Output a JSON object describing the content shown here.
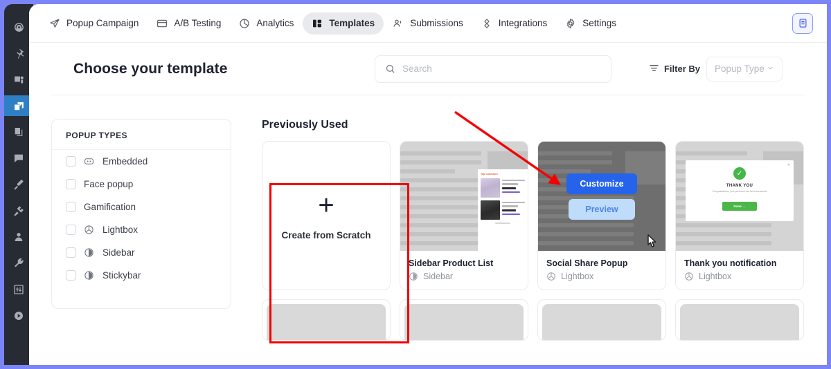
{
  "rail": {
    "items": [
      {
        "name": "dashboard-icon",
        "label": "Dashboard"
      },
      {
        "name": "pin-icon",
        "label": "Pinned"
      },
      {
        "name": "media-icon",
        "label": "Media"
      },
      {
        "name": "popup-icon",
        "label": "Popups"
      },
      {
        "name": "pages-icon",
        "label": "Pages"
      },
      {
        "name": "comments-icon",
        "label": "Comments"
      },
      {
        "name": "appearance-icon",
        "label": "Appearance"
      },
      {
        "name": "plugins-icon",
        "label": "Plugins"
      },
      {
        "name": "users-icon",
        "label": "Users"
      },
      {
        "name": "tools-icon",
        "label": "Tools"
      },
      {
        "name": "settings-sliders-icon",
        "label": "Settings"
      },
      {
        "name": "play-icon",
        "label": "Play"
      }
    ],
    "active_index": 3
  },
  "topnav": {
    "items": [
      {
        "label": "Popup Campaign",
        "icon": "send-icon",
        "active": false
      },
      {
        "label": "A/B Testing",
        "icon": "split-test-icon",
        "active": false
      },
      {
        "label": "Analytics",
        "icon": "pie-chart-icon",
        "active": false
      },
      {
        "label": "Templates",
        "icon": "layout-columns-icon",
        "active": true
      },
      {
        "label": "Submissions",
        "icon": "users-icon",
        "active": false
      },
      {
        "label": "Integrations",
        "icon": "integrations-icon",
        "active": false
      },
      {
        "label": "Settings",
        "icon": "gear-icon",
        "active": false
      }
    ],
    "panel_toggle_icon": "sidebar-panel-icon"
  },
  "header": {
    "title": "Choose your template",
    "search_placeholder": "Search",
    "search_value": "",
    "search_icon": "search-icon",
    "filter_label": "Filter By",
    "filter_icon": "filter-icon",
    "filter_select_value": "Popup Type",
    "filter_chevron": "chevron-down-icon"
  },
  "type_panel": {
    "title": "POPUP TYPES",
    "items": [
      {
        "label": "Embedded",
        "icon": "embedded-icon",
        "has_icon": true,
        "checked": false
      },
      {
        "label": "Face popup",
        "icon": "",
        "has_icon": false,
        "checked": false
      },
      {
        "label": "Gamification",
        "icon": "",
        "has_icon": false,
        "checked": false
      },
      {
        "label": "Lightbox",
        "icon": "lightbox-icon",
        "has_icon": true,
        "checked": false
      },
      {
        "label": "Sidebar",
        "icon": "sidebar-icon",
        "has_icon": true,
        "checked": false
      },
      {
        "label": "Stickybar",
        "icon": "stickybar-icon",
        "has_icon": true,
        "checked": false
      }
    ]
  },
  "templates": {
    "section_title": "Previously Used",
    "scratch": {
      "label": "Create from Scratch",
      "plus_icon": "plus-icon",
      "highlighted": true
    },
    "cards": [
      {
        "title": "Sidebar Product List",
        "type": "Sidebar",
        "type_icon": "sidebar-icon",
        "hovered": false,
        "preview_style": "sidebar-product-list",
        "preview_panel": {
          "heading": "Top Collection",
          "products": [
            {
              "price": "$229.50",
              "cta": "ADD TO CART"
            },
            {
              "price": "$229.50",
              "cta": "ADD TO CART"
            }
          ]
        }
      },
      {
        "title": "Social Share Popup",
        "type": "Lightbox",
        "type_icon": "lightbox-icon",
        "hovered": true,
        "preview_style": "social-share",
        "hover_buttons": {
          "customize": "Customize",
          "preview": "Preview"
        }
      },
      {
        "title": "Thank you notification",
        "type": "Lightbox",
        "type_icon": "lightbox-icon",
        "hovered": false,
        "preview_style": "thank-you",
        "popup": {
          "title": "THANK YOU",
          "subtitle": "Congratulations, your purchase has been successful",
          "button": "Done  →",
          "check_icon": "check-circle-icon",
          "close_icon": "close-icon"
        }
      }
    ]
  },
  "annotation": {
    "arrow_color": "#f40000",
    "highlight_color": "#f40000",
    "cursor_icon": "pointer-cursor-icon"
  },
  "colors": {
    "accent": "#7b85f5",
    "primary_button": "#2563eb",
    "secondary_button": "#bfdcfb",
    "rail_bg": "#272b33",
    "rail_active": "#2f7fc4"
  }
}
